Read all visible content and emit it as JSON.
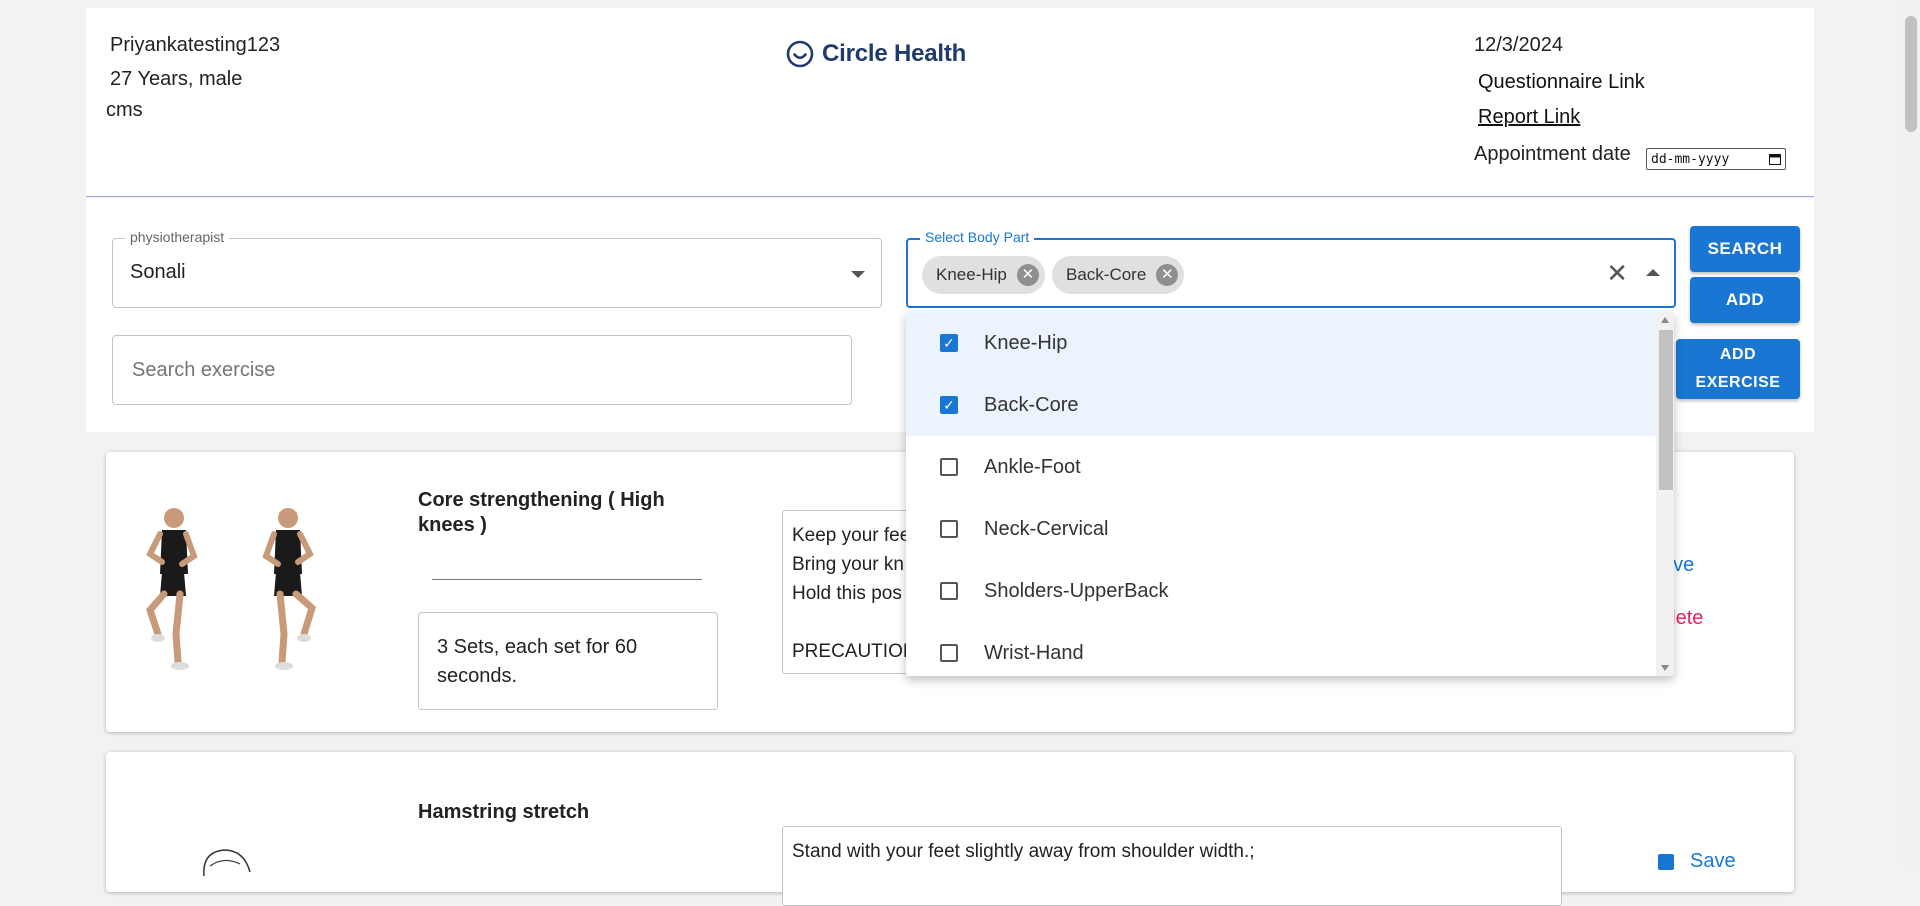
{
  "header": {
    "patient_name": "Priyankatesting123",
    "patient_age": "27 Years, male",
    "patient_unit": "cms",
    "brand_name": "Circle Health",
    "date": "12/3/2024",
    "questionnaire_link": "Questionnaire Link",
    "report_link": "Report Link",
    "appointment_label": "Appointment date",
    "appointment_placeholder": "dd-mm-yyyy"
  },
  "form": {
    "physio_label": "physiotherapist",
    "physio_value": "Sonali",
    "body_label": "Select Body Part",
    "chips": [
      "Knee-Hip",
      "Back-Core"
    ],
    "search_button": "SEARCH",
    "add_button": "ADD",
    "add_exercise_button_line1": "ADD",
    "add_exercise_button_line2": "EXERCISE",
    "search_exercise_placeholder": "Search exercise"
  },
  "body_menu": {
    "items": [
      {
        "label": "Knee-Hip",
        "checked": true
      },
      {
        "label": "Back-Core",
        "checked": true
      },
      {
        "label": "Ankle-Foot",
        "checked": false
      },
      {
        "label": "Neck-Cervical",
        "checked": false
      },
      {
        "label": "Sholders-UpperBack",
        "checked": false
      },
      {
        "label": "Wrist-Hand",
        "checked": false
      }
    ]
  },
  "exercises": [
    {
      "title": "Core strengthening ( High knees )",
      "sets": "3 Sets, each set for 60 seconds.",
      "description": "Keep your fee\nBring your kn\nHold this pos\n\nPRECAUTION",
      "save": "ave",
      "delete": "elete"
    },
    {
      "title": "Hamstring stretch",
      "description": "Stand with your feet slightly away from shoulder width.;",
      "save": "Save"
    }
  ],
  "colors": {
    "primary": "#1976d2",
    "brand": "#1f3b6e",
    "danger": "#e91e63",
    "selected_bg": "#ebf3fc"
  }
}
